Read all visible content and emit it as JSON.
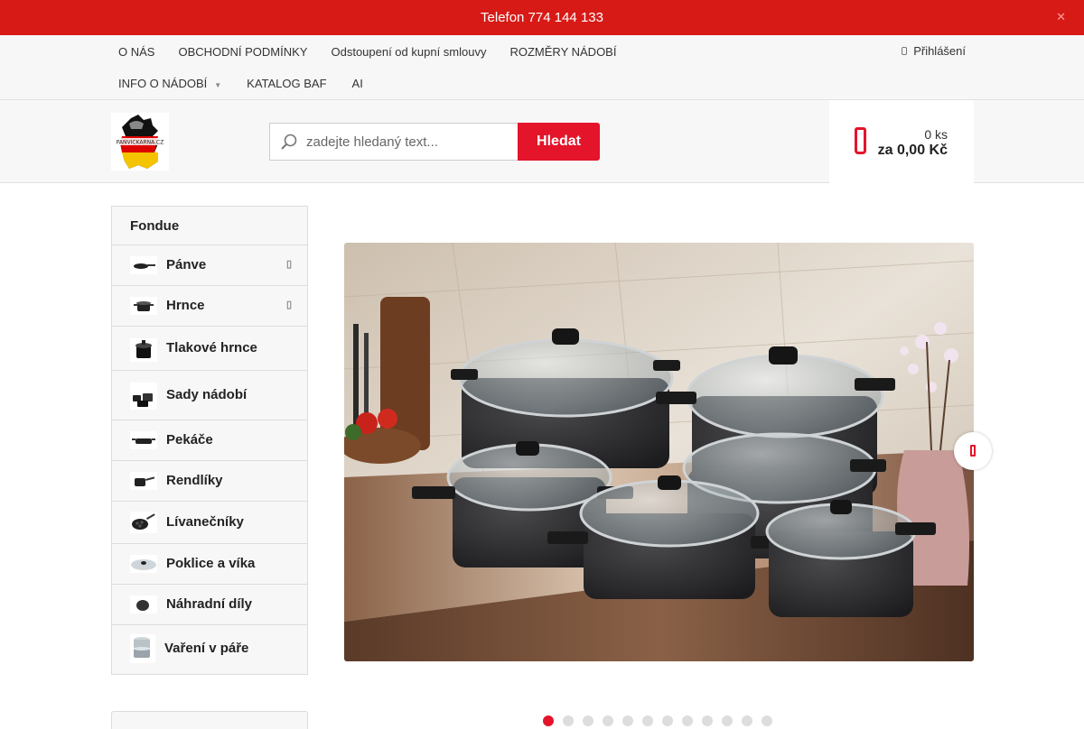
{
  "topbar": {
    "phone": "Telefon 774 144 133",
    "close_icon": "close-icon"
  },
  "nav": {
    "row1": [
      "O NÁS",
      "OBCHODNÍ PODMÍNKY",
      "Odstoupení od kupní smlouvy",
      "ROZMĚRY NÁDOBÍ"
    ],
    "row2": [
      "INFO O NÁDOBÍ",
      "KATALOG BAF",
      "AI"
    ],
    "login": "Přihlášení"
  },
  "header": {
    "logo_text": "PANVICKARNA.CZ",
    "search_placeholder": "zadejte hledaný text...",
    "search_button": "Hledat",
    "cart_qty": "0 ks",
    "cart_total": "za 0,00 Kč"
  },
  "sidebar": {
    "heading": "Fondue",
    "categories": [
      {
        "label": "Pánve",
        "icon": "frying-pan-icon",
        "has_submenu": true
      },
      {
        "label": "Hrnce",
        "icon": "pot-icon",
        "has_submenu": true
      },
      {
        "label": "Tlakové hrnce",
        "icon": "pressure-cooker-icon",
        "has_submenu": false
      },
      {
        "label": "Sady nádobí",
        "icon": "cookware-set-icon",
        "has_submenu": false
      },
      {
        "label": "Pekáče",
        "icon": "roaster-icon",
        "has_submenu": false
      },
      {
        "label": "Rendlíky",
        "icon": "saucepan-icon",
        "has_submenu": false
      },
      {
        "label": "Lívanečníky",
        "icon": "pancake-pan-icon",
        "has_submenu": false
      },
      {
        "label": "Poklice a víka",
        "icon": "lid-icon",
        "has_submenu": false
      },
      {
        "label": "Náhradní díly",
        "icon": "spare-part-icon",
        "has_submenu": false
      },
      {
        "label": "Vaření v páře",
        "icon": "steamer-icon",
        "has_submenu": false
      }
    ]
  },
  "slider": {
    "slide_count": 12,
    "active_index": 0
  },
  "colors": {
    "brand_red": "#d71a16",
    "button_red": "#e4142b"
  }
}
